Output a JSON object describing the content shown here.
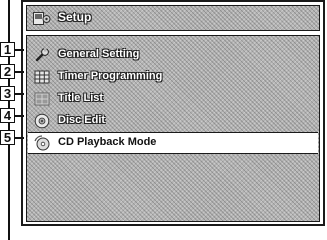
{
  "title_bar": {
    "icon": "setup-icon",
    "label": "Setup"
  },
  "menu": {
    "items": [
      {
        "number": "1",
        "icon": "wrench-icon",
        "label": "General Setting",
        "selected": false
      },
      {
        "number": "2",
        "icon": "timer-grid-icon",
        "label": "Timer Programming",
        "selected": false
      },
      {
        "number": "3",
        "icon": "title-list-icon",
        "label": "Title List",
        "selected": false
      },
      {
        "number": "4",
        "icon": "disc-icon",
        "label": "Disc Edit",
        "selected": false
      },
      {
        "number": "5",
        "icon": "cd-playback-icon",
        "label": "CD Playback Mode",
        "selected": true
      }
    ]
  },
  "colors": {
    "screen_background": "#b4b4b4",
    "selected_background": "#ffffff",
    "frame": "#1a1a1a"
  }
}
